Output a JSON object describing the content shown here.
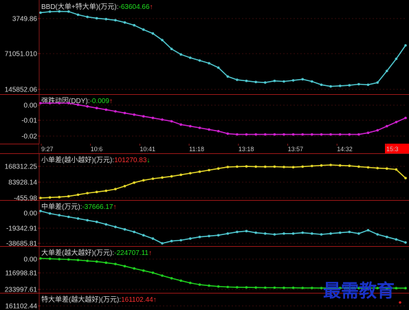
{
  "colors": {
    "background": "#000000",
    "axis_line": "#8b1a1a",
    "panel_divider": "#a01818",
    "grid": "#3a0c0c",
    "label_text": "#d8d8d8",
    "value_positive": "#ff3030",
    "value_negative": "#20e020",
    "cyan": "#4fc8d0",
    "magenta": "#d020d0",
    "yellow": "#e6d82a",
    "green": "#20d020",
    "red": "#e02020",
    "current_time_box": "#ff0000",
    "watermark": "#1a33c8"
  },
  "watermark": {
    "text": "最需教育"
  },
  "time_axis": {
    "labels": [
      "9:27",
      "10:6",
      "10:41",
      "11:18",
      "13:18",
      "13:57",
      "14:32",
      "15:3"
    ]
  },
  "panels": [
    {
      "id": "bbd",
      "title": "BBD(大单+特大单)(万元):",
      "value": "-63604.66",
      "arrow": "↑",
      "arrow_color": "#ff3030",
      "value_color": "#20e020",
      "y_labels": [
        "3749.86",
        "71051.010",
        "145852.06"
      ]
    },
    {
      "id": "ddy",
      "title": "强跌动因(DDY):",
      "value": "-0.009",
      "arrow": "↑",
      "arrow_color": "#ff3030",
      "value_color": "#20e020",
      "y_labels": [
        "0.00",
        "-0.01",
        "-0.02"
      ]
    },
    {
      "id": "small",
      "title": "小单差(越小越好)(万元):",
      "value": "101270.83",
      "arrow": "↓",
      "arrow_color": "#20e020",
      "value_color": "#ff3030",
      "y_labels": [
        "168312.25",
        "83928.14",
        "-455.98"
      ]
    },
    {
      "id": "mid",
      "title": "中单差(万元):",
      "value": "-37666.17",
      "arrow": "↑",
      "arrow_color": "#ff3030",
      "value_color": "#20e020",
      "y_labels": [
        "0.00",
        "-19342.91",
        "-38685.81"
      ]
    },
    {
      "id": "large",
      "title": "大单差(越大越好)(万元):",
      "value": "-224707.11",
      "arrow": "↑",
      "arrow_color": "#ff3030",
      "value_color": "#20e020",
      "y_labels": [
        "0.00",
        "116998.81",
        "233997.61"
      ]
    },
    {
      "id": "xlarge",
      "title": "特大单差(越大越好)(万元):",
      "value": "161102.44",
      "arrow": "↑",
      "arrow_color": "#ff3030",
      "value_color": "#ff3030",
      "y_labels": [
        "161102.44"
      ]
    }
  ],
  "chart_data": [
    {
      "type": "line",
      "title": "BBD(大单+特大单)(万元)",
      "series": [
        {
          "name": "BBD(大单+特大单)(万元)",
          "values": [
            -4200,
            -2500,
            -2000,
            -2200,
            -8000,
            -12000,
            -14500,
            -16000,
            -18000,
            -22000,
            -27000,
            -35000,
            -42000,
            -54000,
            -70000,
            -80000,
            -86000,
            -91000,
            -96000,
            -104000,
            -120000,
            -126000,
            -128000,
            -130000,
            -131000,
            -128000,
            -129000,
            -127000,
            -125000,
            -129000,
            -135000,
            -138000,
            -137000,
            -136000,
            -134000,
            -135000,
            -131000,
            -110000,
            -88000,
            -63604.66
          ]
        }
      ]
    },
    {
      "type": "line",
      "title": "强跌动因(DDY)",
      "series": [
        {
          "name": "强跌动因(DDY)",
          "values": [
            0.0,
            0.0,
            0.0,
            0.0,
            -0.001,
            -0.002,
            -0.003,
            -0.004,
            -0.005,
            -0.006,
            -0.007,
            -0.008,
            -0.009,
            -0.01,
            -0.011,
            -0.013,
            -0.014,
            -0.015,
            -0.016,
            -0.017,
            -0.0185,
            -0.019,
            -0.019,
            -0.019,
            -0.019,
            -0.019,
            -0.019,
            -0.019,
            -0.019,
            -0.019,
            -0.019,
            -0.019,
            -0.019,
            -0.019,
            -0.019,
            -0.018,
            -0.0165,
            -0.014,
            -0.0115,
            -0.009
          ]
        }
      ]
    },
    {
      "type": "line",
      "title": "小单差(越小越好)(万元)",
      "series": [
        {
          "name": "小单差(越小越好)(万元)",
          "values": [
            -455.98,
            2000,
            4000,
            8000,
            16000,
            24000,
            30000,
            36000,
            45000,
            60000,
            78000,
            90000,
            98000,
            104000,
            110000,
            118000,
            126000,
            134000,
            142000,
            150000,
            158000,
            160000,
            161000,
            160000,
            159000,
            160000,
            158000,
            157000,
            160000,
            163000,
            166000,
            168312.25,
            166000,
            164000,
            160000,
            156000,
            152000,
            150000,
            145000,
            101270.83
          ]
        }
      ]
    },
    {
      "type": "line",
      "title": "中单差(万元)",
      "series": [
        {
          "name": "中单差(万元)",
          "values": [
            0,
            -3000,
            -5000,
            -7000,
            -9000,
            -11000,
            -13000,
            -16000,
            -19000,
            -22000,
            -25000,
            -29000,
            -33000,
            -38685.81,
            -36000,
            -35000,
            -33000,
            -31000,
            -30000,
            -29000,
            -27000,
            -25000,
            -24000,
            -26000,
            -27000,
            -28000,
            -27000,
            -27000,
            -26000,
            -27000,
            -28000,
            -27000,
            -26000,
            -25000,
            -27000,
            -23000,
            -28000,
            -31000,
            -34000,
            -37666.17
          ]
        }
      ]
    },
    {
      "type": "line",
      "title": "大单差(越大越好)(万元)",
      "series": [
        {
          "name": "大单差(越大越好)(万元)",
          "values": [
            0,
            -2000,
            -5000,
            -8000,
            -12000,
            -18000,
            -24000,
            -32000,
            -42000,
            -58000,
            -76000,
            -92000,
            -108000,
            -130000,
            -150000,
            -168000,
            -185000,
            -198000,
            -206000,
            -212000,
            -216000,
            -218000,
            -219000,
            -220000,
            -221000,
            -221000,
            -222000,
            -222000,
            -223000,
            -223000,
            -224000,
            -224000,
            -224000,
            -224000,
            -224000,
            -224000,
            -224000,
            -224000,
            -224500,
            -224707.11
          ]
        }
      ]
    },
    {
      "type": "line",
      "title": "特大单差(越大越好)(万元)",
      "series": [
        {
          "name": "特大单差(越大越好)(万元)",
          "values": [
            161102.44
          ]
        }
      ]
    }
  ]
}
